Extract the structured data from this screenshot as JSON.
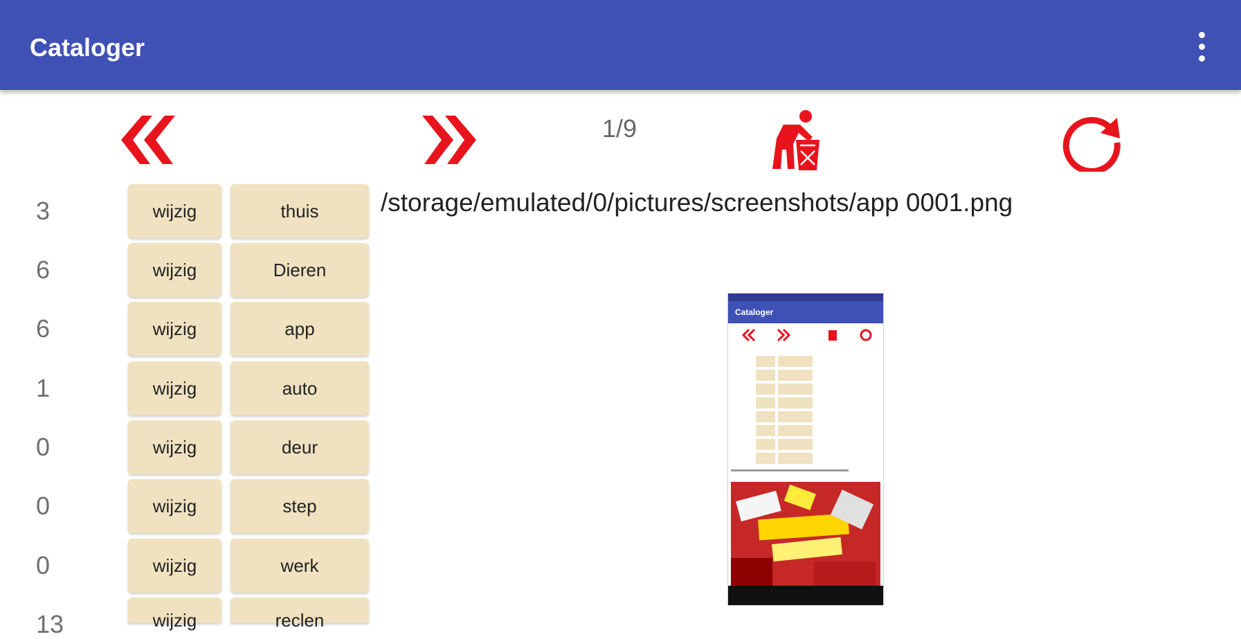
{
  "app": {
    "title": "Cataloger"
  },
  "toolbar": {
    "counter": "1/9"
  },
  "rows": [
    {
      "count": "3",
      "edit": "wijzig",
      "tag": "thuis"
    },
    {
      "count": "6",
      "edit": "wijzig",
      "tag": "Dieren"
    },
    {
      "count": "6",
      "edit": "wijzig",
      "tag": "app"
    },
    {
      "count": "1",
      "edit": "wijzig",
      "tag": "auto"
    },
    {
      "count": "0",
      "edit": "wijzig",
      "tag": "deur"
    },
    {
      "count": "0",
      "edit": "wijzig",
      "tag": "step"
    },
    {
      "count": "0",
      "edit": "wijzig",
      "tag": "werk"
    },
    {
      "count": "13",
      "edit": "wijzig",
      "tag": "reclen"
    }
  ],
  "file": {
    "path": "/storage/emulated/0/pictures/screenshots/app 0001.png"
  },
  "preview": {
    "title": "Cataloger"
  },
  "icons": {
    "prev": "double-chevron-left-icon",
    "next": "double-chevron-right-icon",
    "delete": "trash-person-icon",
    "refresh": "refresh-icon",
    "menu": "more-vert-icon"
  },
  "colors": {
    "appbar": "#3f51b5",
    "accent": "#e8141d",
    "button": "#f0e2c0"
  }
}
